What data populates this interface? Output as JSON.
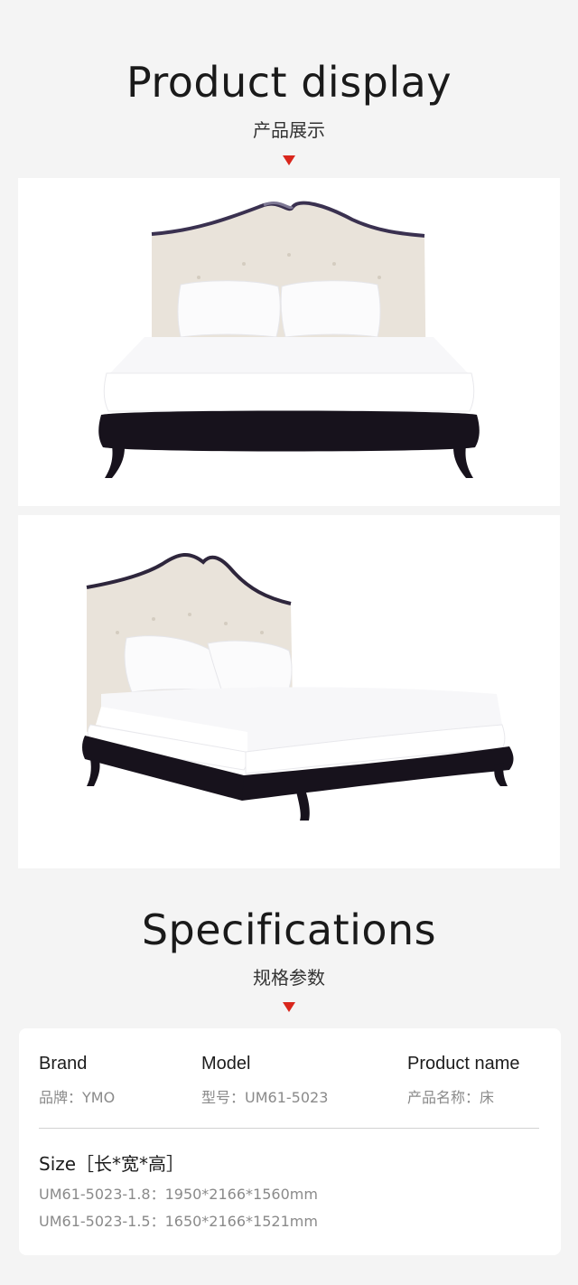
{
  "display": {
    "title": "Product display",
    "subtitle": "产品展示"
  },
  "specs_section": {
    "title": "Specifications",
    "subtitle": "规格参数"
  },
  "specs": {
    "brand": {
      "label": "Brand",
      "value": "品牌：YMO"
    },
    "model": {
      "label": "Model",
      "value": "型号：UM61-5023"
    },
    "product_name": {
      "label": "Product name",
      "value": "产品名称：床"
    },
    "size": {
      "label": "Size［长*宽*高］",
      "rows": [
        "UM61-5023-1.8：1950*2166*1560mm",
        "UM61-5023-1.5：1650*2166*1521mm"
      ]
    }
  },
  "colors": {
    "accent": "#d9261c",
    "background": "#f4f4f4",
    "card": "#ffffff"
  },
  "icons": {
    "pointer": "down-triangle-icon"
  }
}
